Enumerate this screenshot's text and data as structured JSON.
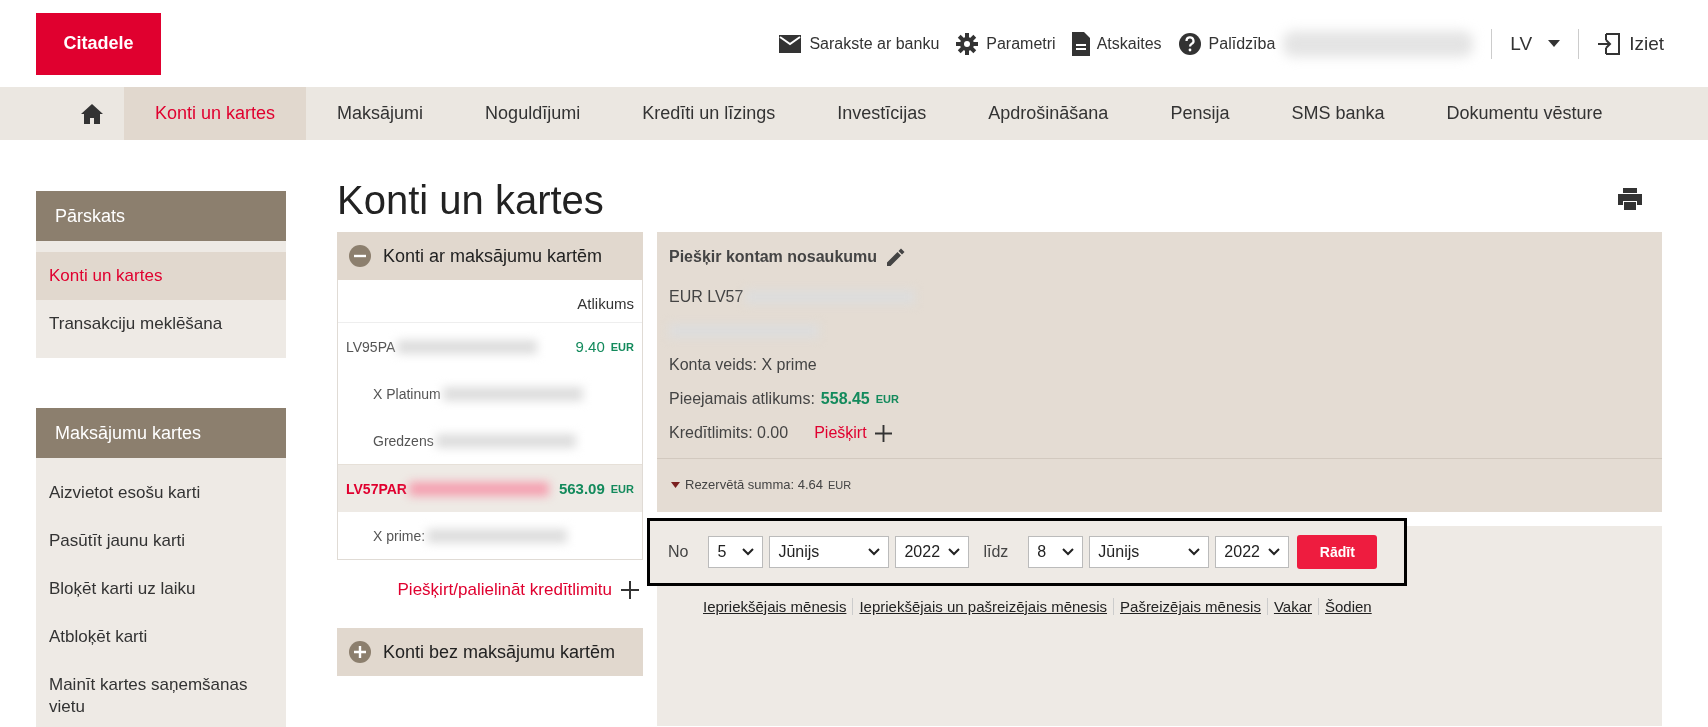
{
  "header": {
    "logo": "Citadele",
    "links": [
      {
        "kind": "mail",
        "label": "Sarakste ar banku"
      },
      {
        "kind": "gear",
        "label": "Parametri"
      },
      {
        "kind": "doc",
        "label": "Atskaites"
      },
      {
        "kind": "help",
        "label": "Palīdzība"
      }
    ],
    "language": "LV",
    "logout": "Iziet"
  },
  "nav": [
    {
      "label": "Konti un kartes",
      "selected": true
    },
    {
      "label": "Maksājumi",
      "selected": false
    },
    {
      "label": "Noguldījumi",
      "selected": false
    },
    {
      "label": "Kredīti un līzings",
      "selected": false
    },
    {
      "label": "Investīcijas",
      "selected": false
    },
    {
      "label": "Apdrošināšana",
      "selected": false
    },
    {
      "label": "Pensija",
      "selected": false
    },
    {
      "label": "SMS banka",
      "selected": false
    },
    {
      "label": "Dokumentu vēsture",
      "selected": false
    }
  ],
  "sidebar": [
    {
      "title": "Pārskats",
      "items": [
        {
          "label": "Konti un kartes",
          "selected": true
        },
        {
          "label": "Transakciju meklēšana",
          "selected": false
        }
      ]
    },
    {
      "title": "Maksājumu kartes",
      "items": [
        {
          "label": "Aizvietot esošu karti",
          "selected": false
        },
        {
          "label": "Pasūtīt jaunu karti",
          "selected": false
        },
        {
          "label": "Bloķēt karti uz laiku",
          "selected": false
        },
        {
          "label": "Atbloķēt karti",
          "selected": false
        },
        {
          "label": "Mainīt kartes saņemšanas vietu",
          "selected": false
        }
      ]
    }
  ],
  "page_title": "Konti un kartes",
  "account_groups": [
    {
      "title": "Konti ar maksājumu kartēm",
      "expanded": true,
      "column": "Atlikums",
      "rows": [
        {
          "kind": "account",
          "text": "LV95PA",
          "amount": "9.40",
          "currency": "EUR",
          "selected": false
        },
        {
          "kind": "card",
          "text": "X Platinum"
        },
        {
          "kind": "card",
          "text": "Gredzens"
        },
        {
          "kind": "account",
          "text": "LV57PAR",
          "amount": "563.09",
          "currency": "EUR",
          "selected": true
        },
        {
          "kind": "card",
          "text": "X prime:"
        }
      ],
      "link": "Piešķirt/palielināt kredītlimitu"
    },
    {
      "title": "Konti bez maksājumu kartēm",
      "expanded": false
    }
  ],
  "details": {
    "title": "Piešķir kontam nosaukumu",
    "account": "EUR LV57",
    "type": "Konta veids: X prime",
    "available_label": "Pieejamais atlikums:",
    "available": "558.45",
    "available_currency": "EUR",
    "credit": "Kredītlimits: 0.00",
    "assign": "Piešķirt",
    "reserved": "Rezervētā summa: 4.64",
    "reserved_currency": "EUR"
  },
  "filter": {
    "from_label": "No",
    "from_day": "5",
    "from_month": "Jūnijs",
    "from_year": "2022",
    "to_label": "līdz",
    "to_day": "8",
    "to_month": "Jūnijs",
    "to_year": "2022",
    "button": "Rādīt",
    "quick_links": [
      "Iepriekšējais mēnesis",
      "Iepriekšējais un pašreizējais mēnesis",
      "Pašreizējais mēnesis",
      "Vakar",
      "Šodien"
    ]
  }
}
